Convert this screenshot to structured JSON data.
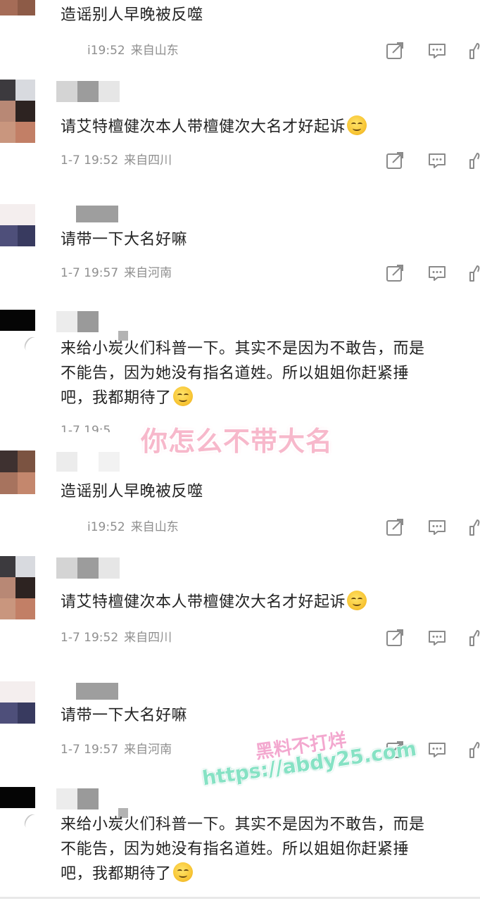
{
  "comments": [
    {
      "text_lines": [
        "造谣别人早晚被反噬"
      ],
      "time": "19:52",
      "time_prefix": "i",
      "location": "来自山东",
      "emoji": false
    },
    {
      "text_lines": [
        "请艾特檀健次本人带檀健次大名才好起诉"
      ],
      "time": "1-7 19:52",
      "location": "来自四川",
      "emoji": true
    },
    {
      "text_lines": [
        "请带一下大名好嘛"
      ],
      "time": "1-7 19:57",
      "location": "来自河南",
      "emoji": false
    },
    {
      "text_lines": [
        "来给小炭火们科普一下。其实不是因为不敢告，而是",
        "不能告，因为她没有指名道姓。所以姐姐你赶紧捶",
        "吧，我都期待了"
      ],
      "time": "1-7 19:5",
      "location": "",
      "emoji": true
    },
    {
      "text_lines": [
        "造谣别人早晚被反噬"
      ],
      "time": "19:52",
      "time_prefix": "i",
      "location": "来自山东",
      "emoji": false
    },
    {
      "text_lines": [
        "请艾特檀健次本人带檀健次大名才好起诉"
      ],
      "time": "1-7 19:52",
      "location": "来自四川",
      "emoji": true
    },
    {
      "text_lines": [
        "请带一下大名好嘛"
      ],
      "time": "1-7 19:57",
      "location": "来自河南",
      "emoji": false
    },
    {
      "text_lines": [
        "来给小炭火们科普一下。其实不是因为不敢告，而是",
        "不能告，因为她没有指名道姓。所以姐姐你赶紧捶",
        "吧，我都期待了"
      ],
      "time": "",
      "location": "",
      "emoji": true
    }
  ],
  "icons": {
    "share": "share-icon",
    "comment": "comment-icon",
    "like": "like-icon"
  },
  "overlays": {
    "pink_caption": "你怎么不带大名",
    "watermark_line1": "黑料不打烊",
    "watermark_line2": "https://abdy25.com"
  },
  "colors": {
    "pink": "#f5b4c6",
    "watermark_green": "#7fe0c0",
    "watermark_pink": "#f4a7d0"
  }
}
